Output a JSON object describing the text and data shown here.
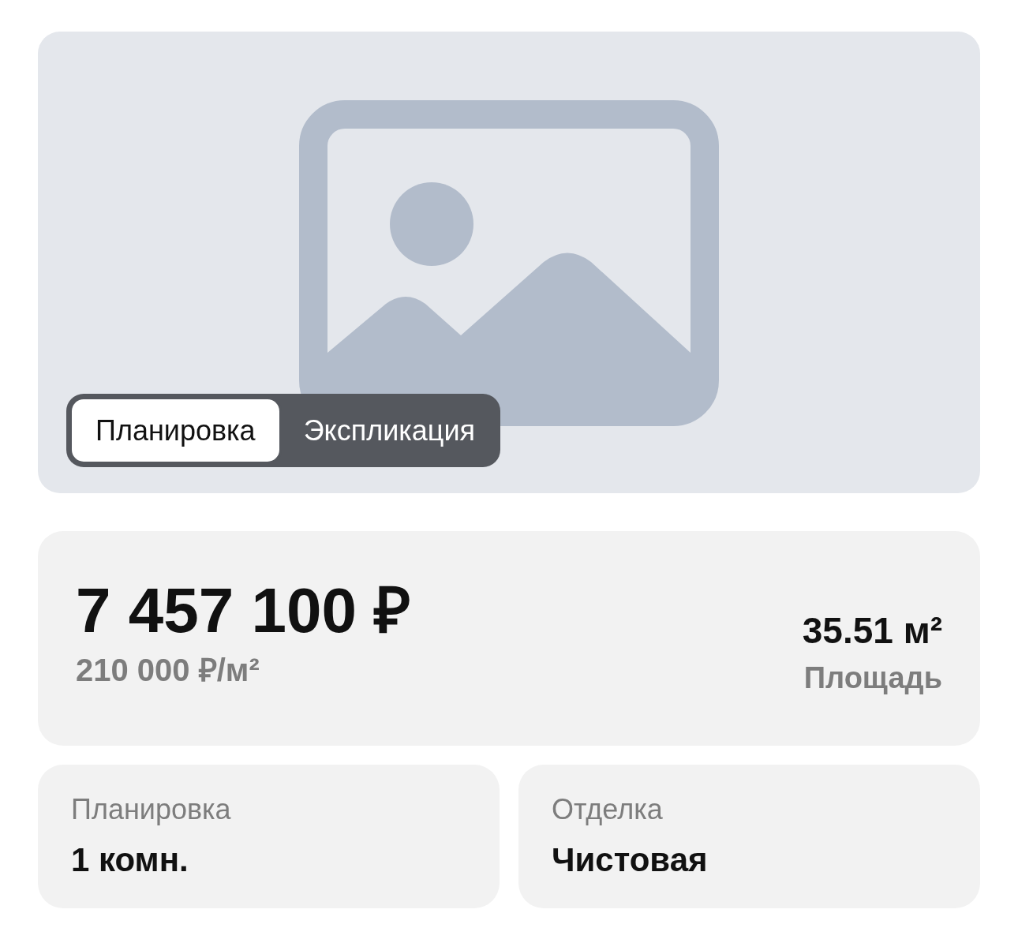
{
  "photo": {
    "tabs": [
      {
        "label": "Планировка",
        "selected": true
      },
      {
        "label": "Экспликация",
        "selected": false
      }
    ]
  },
  "price": {
    "total": "7 457 100 ₽",
    "per_meter": "210 000 ₽/м²"
  },
  "area": {
    "value": "35.51 м²",
    "label": "Площадь"
  },
  "details": [
    {
      "label": "Планировка",
      "value": "1 комн."
    },
    {
      "label": "Отделка",
      "value": "Чистовая"
    }
  ]
}
